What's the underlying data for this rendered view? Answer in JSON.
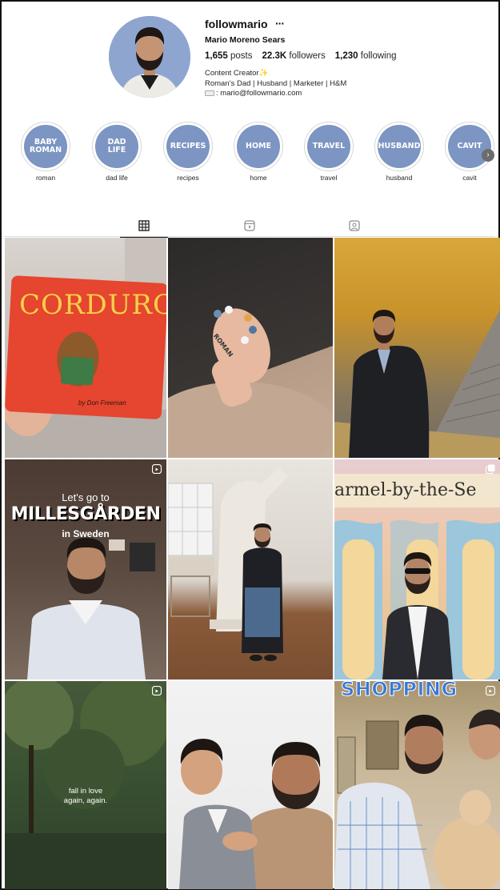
{
  "profile": {
    "username": "followmario",
    "more_glyph": "···",
    "full_name": "Mario Moreno Sears",
    "stats": {
      "posts_count": "1,655",
      "posts_label": "posts",
      "followers_count": "22.3K",
      "followers_label": "followers",
      "following_count": "1,230",
      "following_label": "following"
    },
    "bio": {
      "line1": "Content Creator",
      "sparkle": "✨",
      "line2": "Roman’s Dad | Husband | Marketer | H&M",
      "email": ": mario@followmario.com"
    }
  },
  "highlights": [
    {
      "title": "BABY ROMAN",
      "label": "roman"
    },
    {
      "title": "DAD LIFE",
      "label": "dad life"
    },
    {
      "title": "RECIPES",
      "label": "recipes"
    },
    {
      "title": "HOME",
      "label": "home"
    },
    {
      "title": "TRAVEL",
      "label": "travel"
    },
    {
      "title": "HUSBAND",
      "label": "husband"
    },
    {
      "title": "CAVIT",
      "label": "cavit"
    }
  ],
  "tabs": [
    {
      "icon": "grid-icon",
      "active": true
    },
    {
      "icon": "reels-icon",
      "active": false
    },
    {
      "icon": "tagged-icon",
      "active": false
    }
  ],
  "posts": {
    "p1": {
      "text": "CORDUROY",
      "byline": "by Don Freeman"
    },
    "p2": {
      "text": "ROMAN"
    },
    "p4": {
      "line1": "Let's go to",
      "line2": "MILLESGÅRDEN",
      "line3": "in Sweden"
    },
    "p6": {
      "text": "armel-by-the-Se"
    },
    "p7": {
      "line1": "fall in love",
      "line2": "again, again."
    },
    "p9": {
      "text": "SHOPPING"
    }
  },
  "colors": {
    "highlight_fill": "#7c95c2",
    "avatar_bg": "#8ea6cf"
  }
}
